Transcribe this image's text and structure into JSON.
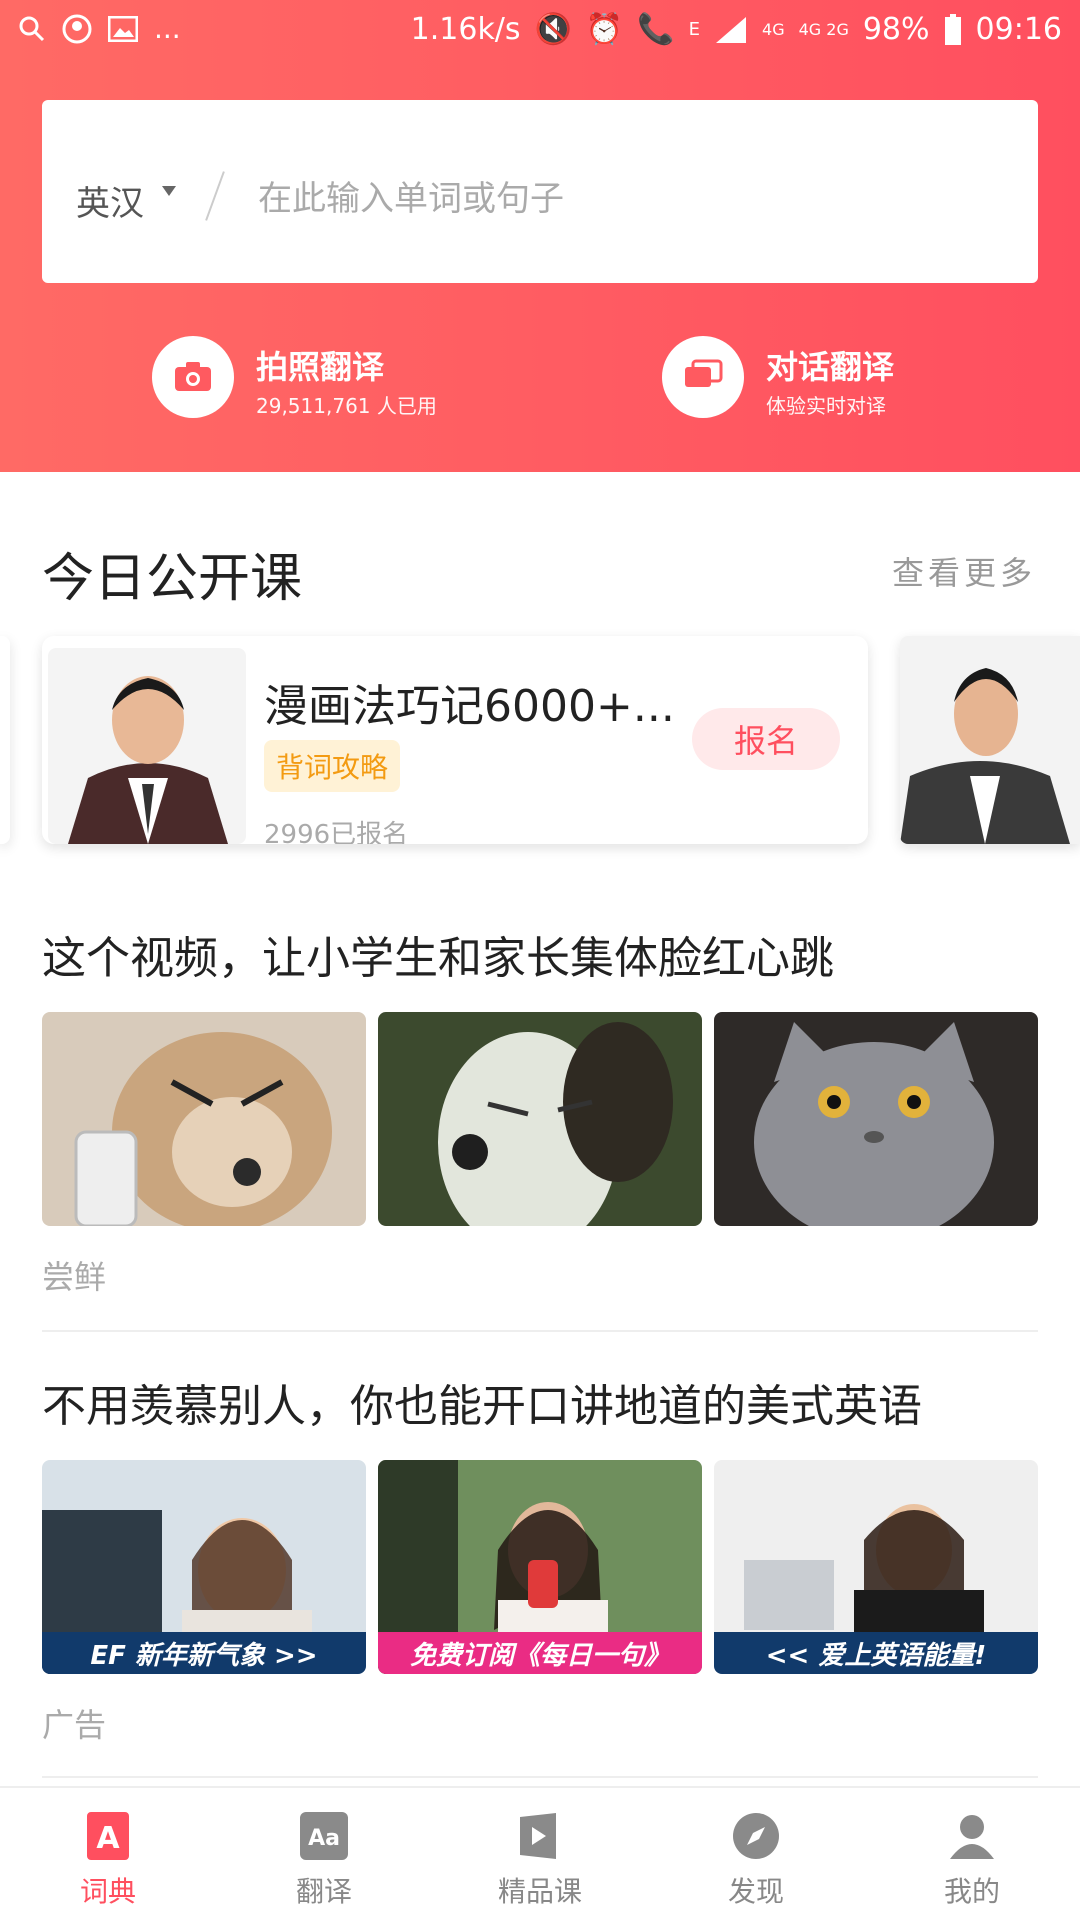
{
  "status_bar": {
    "speed": "1.16k/s",
    "network": "E",
    "lte": "4G",
    "lte2": "4G 2G",
    "battery": "98%",
    "time": "09:16",
    "dots": "..."
  },
  "search": {
    "lang": "英汉",
    "placeholder": "在此输入单词或句子"
  },
  "features": {
    "photo": {
      "label": "拍照翻译",
      "sub": "29,511,761  人已用"
    },
    "dialog": {
      "label": "对话翻译",
      "sub": "体验实时对译"
    }
  },
  "courses": {
    "title": "今日公开课",
    "more": "查看更多",
    "card": {
      "title": "漫画法巧记6000+...",
      "tag": "背词攻略",
      "count": "2996已报名",
      "enroll": "报名"
    }
  },
  "articles": [
    {
      "title": "这个视频，让小学生和家长集体脸红心跳",
      "meta": "尝鲜",
      "thumbs": [
        "",
        "",
        ""
      ]
    },
    {
      "title": "不用羡慕别人，你也能开口讲地道的美式英语",
      "meta": "广告",
      "thumbs": [
        "EF   新年新气象 >>",
        "免费订阅《每日一句》",
        "<<  爱上英语能量!"
      ]
    }
  ],
  "tabs": [
    {
      "label": "词典",
      "icon": "dictionary-icon"
    },
    {
      "label": "翻译",
      "icon": "translate-icon"
    },
    {
      "label": "精品课",
      "icon": "course-icon"
    },
    {
      "label": "发现",
      "icon": "compass-icon"
    },
    {
      "label": "我的",
      "icon": "profile-icon"
    }
  ],
  "colors": {
    "brand": "#ff4f5f",
    "tag": "#f39b12",
    "banner_blue": "#113a6b",
    "banner_pink": "#ea2c84"
  }
}
